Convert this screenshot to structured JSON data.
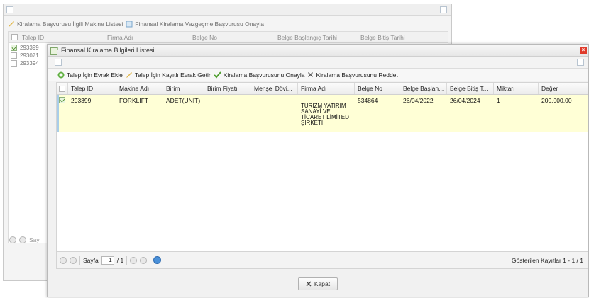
{
  "background_window": {
    "toolbar": {
      "item1": "Kiralama Başvurusu İlgili Makine Listesi",
      "item2": "Finansal Kiralama Vazgeçme Başvurusu Onayla"
    },
    "columns": [
      "Talep ID",
      "Firma Adı",
      "Belge No",
      "Belge Başlangıç Tarihi",
      "Belge Bitiş Tarihi"
    ],
    "rows": [
      "293399",
      "293071",
      "293394"
    ],
    "pager_label": "Say"
  },
  "dialog": {
    "title": "Finansal Kiralama Bilgileri Listesi",
    "toolbar": {
      "add_doc": "Talep İçin Evrak Ekle",
      "get_doc": "Talep İçin Kayıtlı Evrak Getir",
      "approve": "Kiralama Başvurusunu Onayla",
      "reject": "Kiralama Başvurusunu Reddet"
    },
    "columns": [
      "Talep ID",
      "Makine Adı",
      "Birim",
      "Birim Fiyatı",
      "Menşei Dövi...",
      "Firma Adı",
      "Belge No",
      "Belge Başlan...",
      "Belge Bitiş T...",
      "Miktarı",
      "Değer"
    ],
    "row": {
      "talep_id": "293399",
      "makine_adi": "FORKLİFT",
      "birim": "ADET(UNIT)",
      "birim_fiyati": "",
      "mensei_doviz": "",
      "firma_adi_lines": [
        "TURİZM YATIRIM",
        "SANAYİ VE",
        "TİCARET LİMİTED",
        "ŞİRKETİ"
      ],
      "belge_no": "534864",
      "belge_baslangic": "26/04/2022",
      "belge_bitis": "26/04/2024",
      "miktari": "1",
      "deger": "200.000,00"
    },
    "pager": {
      "label": "Sayfa",
      "page": "1",
      "of": "/ 1",
      "info": "Gösterilen Kayıtlar 1 - 1 / 1"
    },
    "close_button": "Kapat"
  },
  "colors": {
    "row_highlight": "#ffffd6",
    "close_red": "#e03b2b",
    "accent_green": "#4f8f2f"
  }
}
